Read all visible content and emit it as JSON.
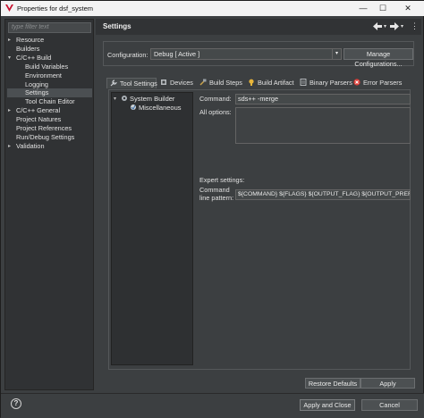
{
  "window": {
    "title": "Properties for dsf_system",
    "controls": [
      "—",
      "☐",
      "✕"
    ]
  },
  "left_panel": {
    "filter_placeholder": "type filter text",
    "items": [
      {
        "label": "Resource",
        "indent": 0,
        "expandable": true
      },
      {
        "label": "Builders",
        "indent": 0,
        "expandable": false
      },
      {
        "label": "C/C++ Build",
        "indent": 0,
        "expandable": true,
        "expanded": true
      },
      {
        "label": "Build Variables",
        "indent": 1,
        "expandable": false
      },
      {
        "label": "Environment",
        "indent": 1,
        "expandable": false
      },
      {
        "label": "Logging",
        "indent": 1,
        "expandable": false
      },
      {
        "label": "Settings",
        "indent": 1,
        "expandable": false,
        "selected": true
      },
      {
        "label": "Tool Chain Editor",
        "indent": 1,
        "expandable": false
      },
      {
        "label": "C/C++ General",
        "indent": 0,
        "expandable": true
      },
      {
        "label": "Project Natures",
        "indent": 0,
        "expandable": false
      },
      {
        "label": "Project References",
        "indent": 0,
        "expandable": false
      },
      {
        "label": "Run/Debug Settings",
        "indent": 0,
        "expandable": false
      },
      {
        "label": "Validation",
        "indent": 0,
        "expandable": true
      }
    ]
  },
  "header": {
    "title": "Settings",
    "back_icon": "arrow-left-icon",
    "forward_icon": "arrow-right-icon",
    "menu_icon": "menu-icon"
  },
  "configuration": {
    "label": "Configuration:",
    "value": "Debug  [ Active ]",
    "manage_button": "Manage Configurations..."
  },
  "tabs": [
    {
      "label": "Tool Settings",
      "icon": "wrench-icon",
      "active": true
    },
    {
      "label": "Devices",
      "icon": "device-icon"
    },
    {
      "label": "Build Steps",
      "icon": "build-steps-icon"
    },
    {
      "label": "Build Artifact",
      "icon": "artifact-icon"
    },
    {
      "label": "Binary Parsers",
      "icon": "parser-icon"
    },
    {
      "label": "Error Parsers",
      "icon": "error-icon"
    }
  ],
  "tool_tree": {
    "root": "System Builder",
    "child": "Miscellaneous"
  },
  "tool_settings": {
    "command_label": "Command:",
    "command_value": "sds++ -merge",
    "all_options_label": "All options:",
    "all_options_value": "",
    "expert_label": "Expert settings:",
    "pattern_label_line1": "Command",
    "pattern_label_line2": "line pattern:",
    "pattern_value": "${COMMAND} ${FLAGS} ${OUTPUT_FLAG} ${OUTPUT_PREFIX}${O"
  },
  "buttons": {
    "restore_defaults": "Restore Defaults",
    "apply": "Apply",
    "apply_close": "Apply and Close",
    "cancel": "Cancel",
    "help": "?"
  },
  "colors": {
    "accent": "#c8102e",
    "background": "#3c3f41",
    "selection": "#4b4f52"
  }
}
